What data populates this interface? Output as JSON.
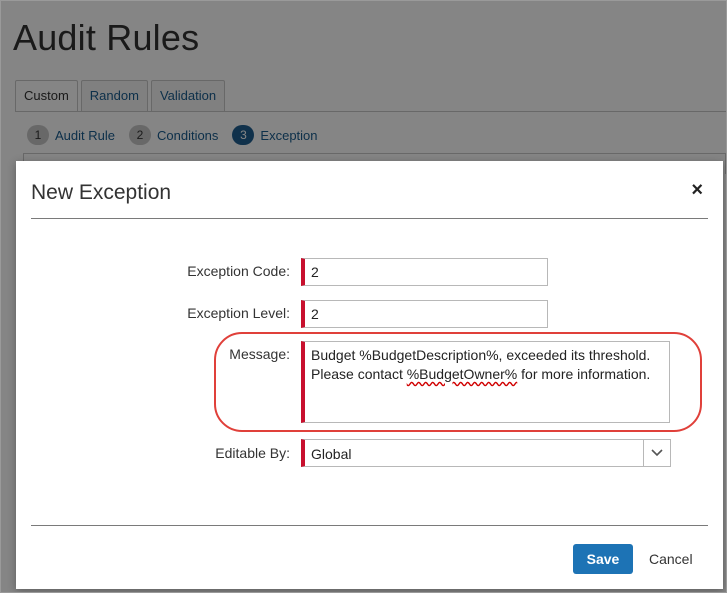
{
  "page": {
    "title": "Audit Rules",
    "tabs": [
      {
        "label": "Custom",
        "active": true
      },
      {
        "label": "Random",
        "active": false
      },
      {
        "label": "Validation",
        "active": false
      }
    ],
    "steps": [
      {
        "num": "1",
        "label": "Audit Rule",
        "current": false
      },
      {
        "num": "2",
        "label": "Conditions",
        "current": false
      },
      {
        "num": "3",
        "label": "Exception",
        "current": true
      }
    ]
  },
  "modal": {
    "title": "New Exception",
    "close_icon": "×",
    "fields": {
      "exception_code": {
        "label": "Exception Code:",
        "value": "2"
      },
      "exception_level": {
        "label": "Exception Level:",
        "value": "2"
      },
      "message": {
        "label": "Message:",
        "line1": "Budget %BudgetDescription%, exceeded its threshold.",
        "line2_pre": "Please contact ",
        "line2_misspelled": "%BudgetOwner%",
        "line2_post": " for more information."
      },
      "editable_by": {
        "label": "Editable By:",
        "value": "Global"
      }
    },
    "save_label": "Save",
    "cancel_label": "Cancel"
  },
  "colors": {
    "accent": "#1d73b5",
    "required_marker": "#c8102e",
    "highlight_ring": "#e0403a",
    "current_step": "#1f5f91"
  },
  "icons": {
    "close": "close-icon",
    "dropdown": "chevron-down-icon"
  }
}
